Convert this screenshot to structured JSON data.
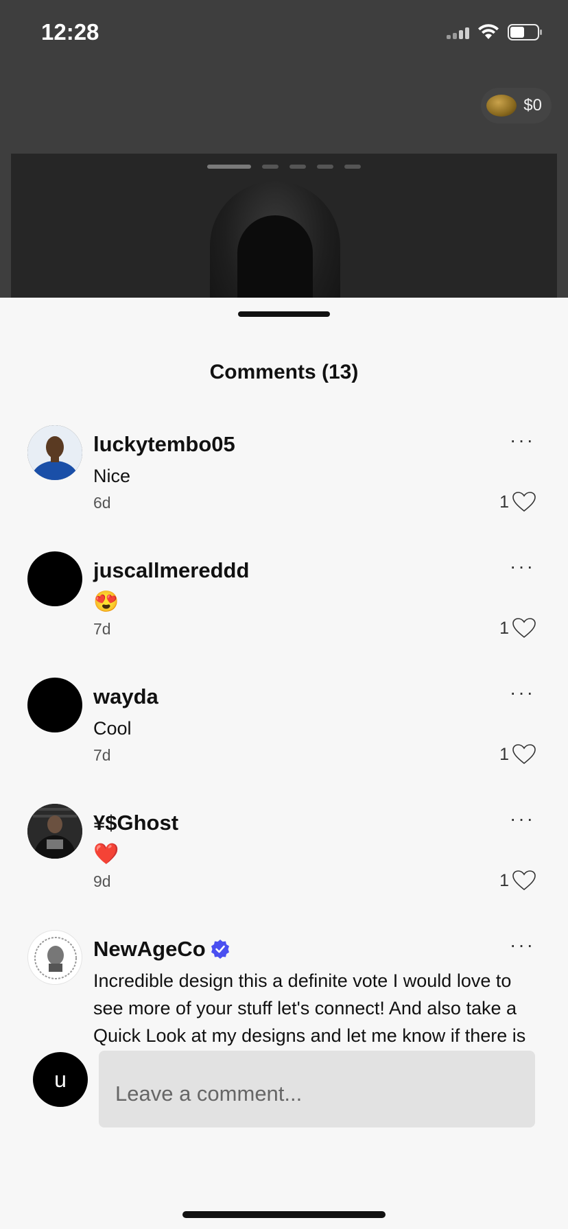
{
  "status_bar": {
    "time": "12:28"
  },
  "header": {
    "coin_balance": "$0"
  },
  "sheet": {
    "title": "Comments (13)"
  },
  "comments": [
    {
      "username": "luckytembo05",
      "text": "Nice",
      "time": "6d",
      "likes": "1",
      "avatar": "photo"
    },
    {
      "username": "juscallmereddd",
      "text": "😍",
      "time": "7d",
      "likes": "1",
      "avatar": "black"
    },
    {
      "username": "wayda",
      "text": "Cool",
      "time": "7d",
      "likes": "1",
      "avatar": "black"
    },
    {
      "username": "¥$Ghost",
      "text": "❤️",
      "time": "9d",
      "likes": "1",
      "avatar": "photo-dark"
    },
    {
      "username": "NewAgeCo",
      "verified": true,
      "text": "Incredible design this a definite vote I would love to see more of your stuff let's connect! And also take a Quick Look at my designs and let me know if there is anything you absolutely love! I will do the same",
      "avatar": "logo"
    }
  ],
  "composer": {
    "avatar_initial": "u",
    "placeholder": "Leave a comment..."
  },
  "more_label": "···",
  "colors": {
    "verified": "#4a4ff0",
    "sheet_bg": "#f7f7f7",
    "input_bg": "#e2e2e2"
  }
}
